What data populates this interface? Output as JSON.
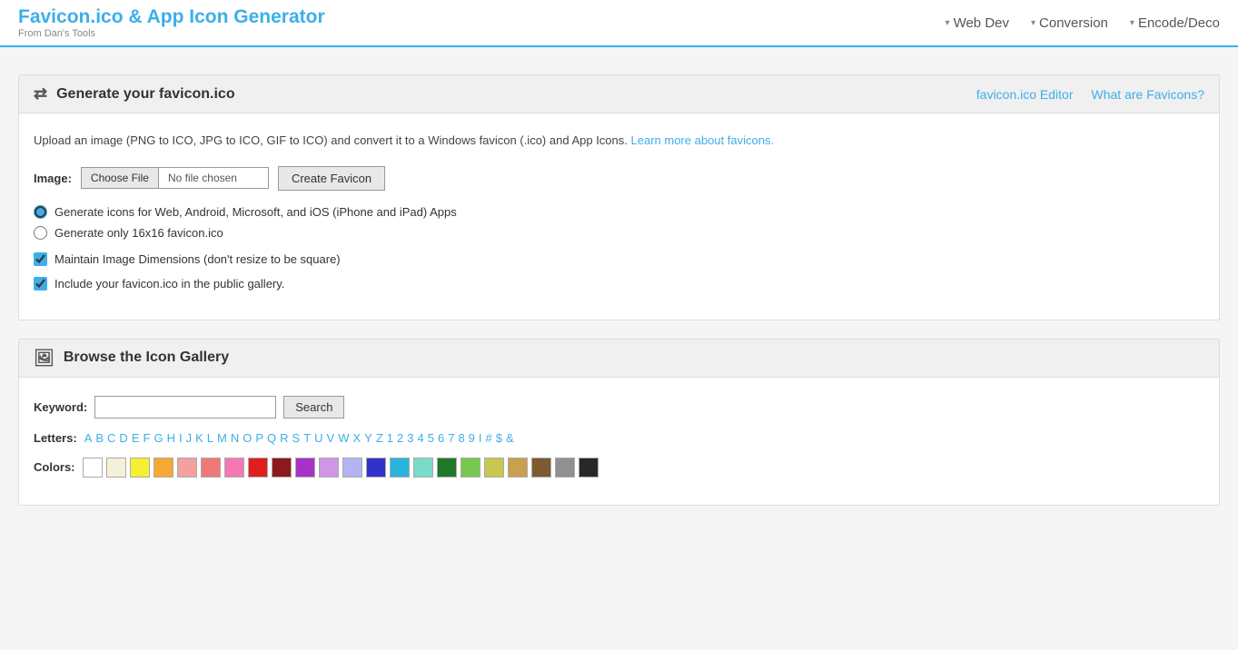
{
  "header": {
    "title": "Favicon.ico & App Icon Generator",
    "subtitle": "From Dan's Tools",
    "nav": [
      {
        "label": "Web Dev",
        "id": "web-dev"
      },
      {
        "label": "Conversion",
        "id": "conversion"
      },
      {
        "label": "Encode/Deco",
        "id": "encode-deco"
      }
    ]
  },
  "favicon_section": {
    "icon": "⇄",
    "title": "Generate your favicon.ico",
    "link1": "favicon.ico Editor",
    "link2": "What are Favicons?",
    "description_main": "Upload an image (PNG to ICO, JPG to ICO, GIF to ICO) and convert it to a Windows favicon (.ico) and App Icons.",
    "description_link_text": "Learn more about favicons.",
    "image_label": "Image:",
    "choose_file_label": "Choose File",
    "no_file_label": "No file chosen",
    "create_btn_label": "Create Favicon",
    "radio1_label": "Generate icons for Web, Android, Microsoft, and iOS (iPhone and iPad) Apps",
    "radio2_label": "Generate only 16x16 favicon.ico",
    "checkbox1_label": "Maintain Image Dimensions (don't resize to be square)",
    "checkbox2_label": "Include your favicon.ico in the public gallery."
  },
  "gallery_section": {
    "icon": "🖼",
    "title": "Browse the Icon Gallery",
    "keyword_label": "Keyword:",
    "keyword_placeholder": "",
    "search_btn_label": "Search",
    "letters_label": "Letters:",
    "letters": [
      "A",
      "B",
      "C",
      "D",
      "E",
      "F",
      "G",
      "H",
      "I",
      "J",
      "K",
      "L",
      "M",
      "N",
      "O",
      "P",
      "Q",
      "R",
      "S",
      "T",
      "U",
      "V",
      "W",
      "X",
      "Y",
      "Z",
      "1",
      "2",
      "3",
      "4",
      "5",
      "6",
      "7",
      "8",
      "9",
      "I",
      "#",
      "$",
      "&"
    ],
    "colors_label": "Colors:",
    "colors": [
      "#ffffff",
      "#f5f0d8",
      "#f5f032",
      "#f5a832",
      "#f5a0a0",
      "#f07878",
      "#f578b4",
      "#e01e1e",
      "#8c1a1a",
      "#a832c8",
      "#d096e6",
      "#b4b4f5",
      "#3232c8",
      "#28b4dc",
      "#78dcc8",
      "#1e7828",
      "#78c850",
      "#c8c850",
      "#c8a050",
      "#7d5a32",
      "#909090",
      "#282828"
    ]
  }
}
